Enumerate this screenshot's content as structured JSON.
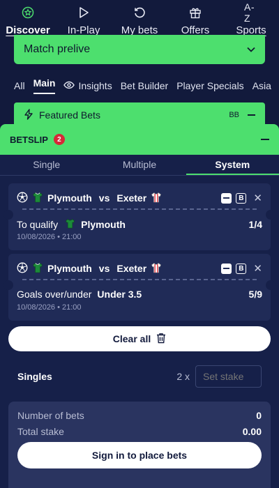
{
  "nav": {
    "items": [
      {
        "label": "Discover",
        "icon": "star-circle-icon"
      },
      {
        "label": "In-Play",
        "icon": "play-icon"
      },
      {
        "label": "My bets",
        "icon": "history-icon"
      },
      {
        "label": "Offers",
        "icon": "gift-icon"
      },
      {
        "label": "Sports",
        "icon": "az-icon",
        "icon_text": "A-Z"
      }
    ],
    "active_index": 0
  },
  "prelive": {
    "label": "Match prelive"
  },
  "tabs": [
    "All",
    "Main",
    "Insights",
    "Bet Builder",
    "Player Specials",
    "Asia"
  ],
  "featured": {
    "label": "Featured Bets",
    "bb": "BB"
  },
  "betslip": {
    "title": "BETSLIP",
    "count": "2",
    "tabs": [
      "Single",
      "Multiple",
      "System"
    ],
    "active_tab": "System",
    "selections": [
      {
        "home": "Plymouth",
        "vs": "vs",
        "away": "Exeter",
        "market": "To qualify",
        "pick": "Plymouth",
        "odds": "1/4",
        "date": "10/08/2026 • 21:00",
        "b_label": "B"
      },
      {
        "home": "Plymouth",
        "vs": "vs",
        "away": "Exeter",
        "market": "Goals over/under",
        "pick": "Under 3.5",
        "odds": "5/9",
        "date": "10/08/2026 • 21:00",
        "b_label": "B"
      }
    ],
    "clear_all": "Clear all",
    "singles": {
      "label": "Singles",
      "count": "2 x",
      "stake_placeholder": "Set stake"
    },
    "summary": {
      "bets_label": "Number of bets",
      "bets_value": "0",
      "stake_label": "Total stake",
      "stake_value": "0.00"
    },
    "signin": "Sign in to place bets"
  },
  "colors": {
    "bg": "#121a3c",
    "accent": "#4ddf6e",
    "badge": "#d62838",
    "card": "#202b57"
  }
}
